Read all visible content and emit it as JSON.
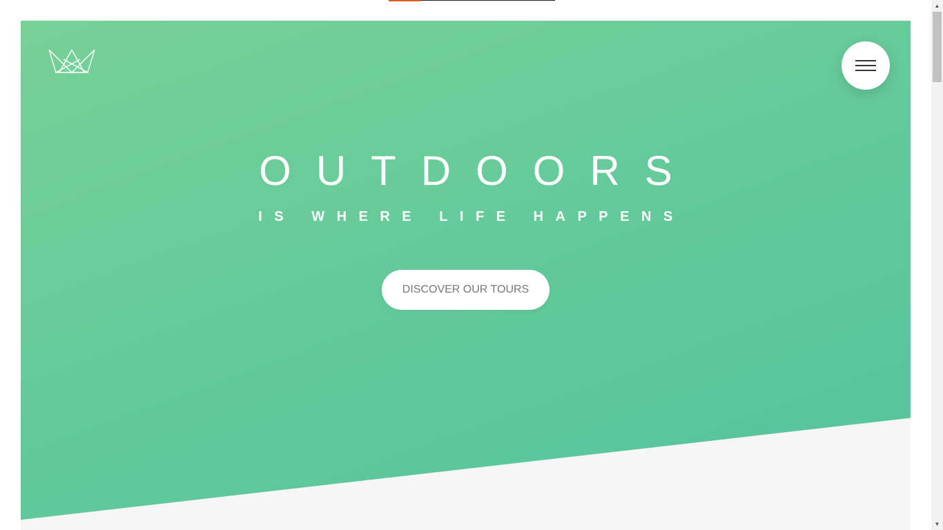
{
  "hero": {
    "title": "OUTDOORS",
    "subtitle": "IS WHERE LIFE HAPPENS",
    "cta_label": "DISCOVER OUR TOURS"
  },
  "icons": {
    "logo": "crown-logo-icon",
    "menu": "hamburger-menu-icon",
    "scroll_up": "scroll-up-arrow-icon",
    "scroll_down": "scroll-down-arrow-icon"
  },
  "colors": {
    "hero_gradient_start": "#77d197",
    "hero_gradient_end": "#55c39d",
    "accent_progress": "#e05a2a",
    "section_background": "#f6f6f6",
    "button_text": "#777777"
  }
}
